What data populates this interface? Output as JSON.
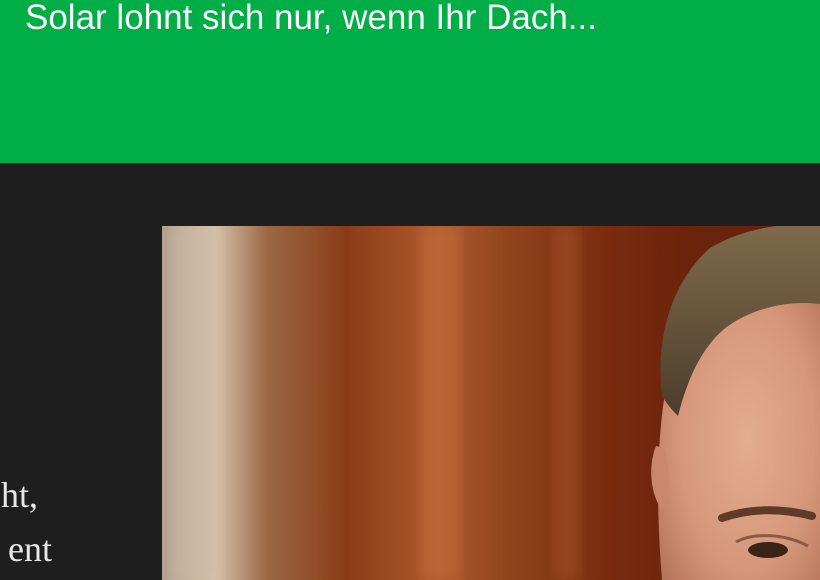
{
  "ad": {
    "headline": "Solar lohnt sich nur, wenn Ihr Dach...",
    "background_color": "#00ad47"
  },
  "article": {
    "text_line_1": "ht,",
    "text_line_2": "ent"
  },
  "photo": {
    "subject": "man-portrait-photo"
  }
}
